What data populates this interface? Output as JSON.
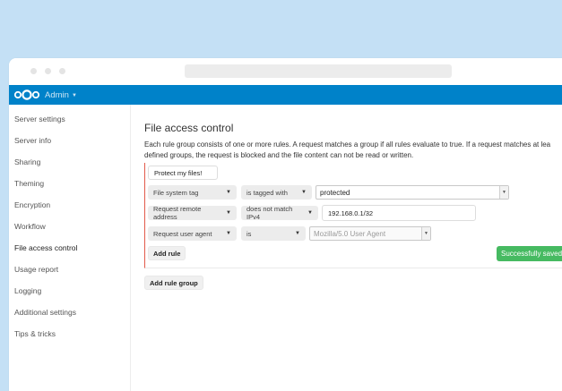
{
  "header": {
    "app_name": "Admin"
  },
  "sidebar": {
    "items": [
      {
        "label": "Server settings"
      },
      {
        "label": "Server info"
      },
      {
        "label": "Sharing"
      },
      {
        "label": "Theming"
      },
      {
        "label": "Encryption"
      },
      {
        "label": "Workflow"
      },
      {
        "label": "File access control",
        "active": true
      },
      {
        "label": "Usage report"
      },
      {
        "label": "Logging"
      },
      {
        "label": "Additional settings"
      },
      {
        "label": "Tips & tricks"
      }
    ]
  },
  "main": {
    "title": "File access control",
    "description_line1": "Each rule group consists of one or more rules. A request matches a group if all rules evaluate to true. If a request matches at lea",
    "description_line2": "defined groups, the request is blocked and the file content can not be read or written.",
    "group": {
      "name": "Protect my files!",
      "rules": [
        {
          "check": "File system tag",
          "operator": "is tagged with",
          "value": "protected"
        },
        {
          "check": "Request remote address",
          "operator": "does not match IPv4",
          "value": "192.168.0.1/32"
        },
        {
          "check": "Request user agent",
          "operator": "is",
          "value": "Mozilla/5.0 User Agent"
        }
      ],
      "add_rule_label": "Add rule",
      "status": "Successfully saved"
    },
    "add_group_label": "Add rule group"
  },
  "colors": {
    "header": "#0082c9",
    "success": "#46ba61",
    "group_border": "#e25a4a",
    "background": "#c4e0f5"
  },
  "icons": {
    "logo": "nextcloud-logo-icon",
    "dropdown": "caret-down-icon"
  }
}
